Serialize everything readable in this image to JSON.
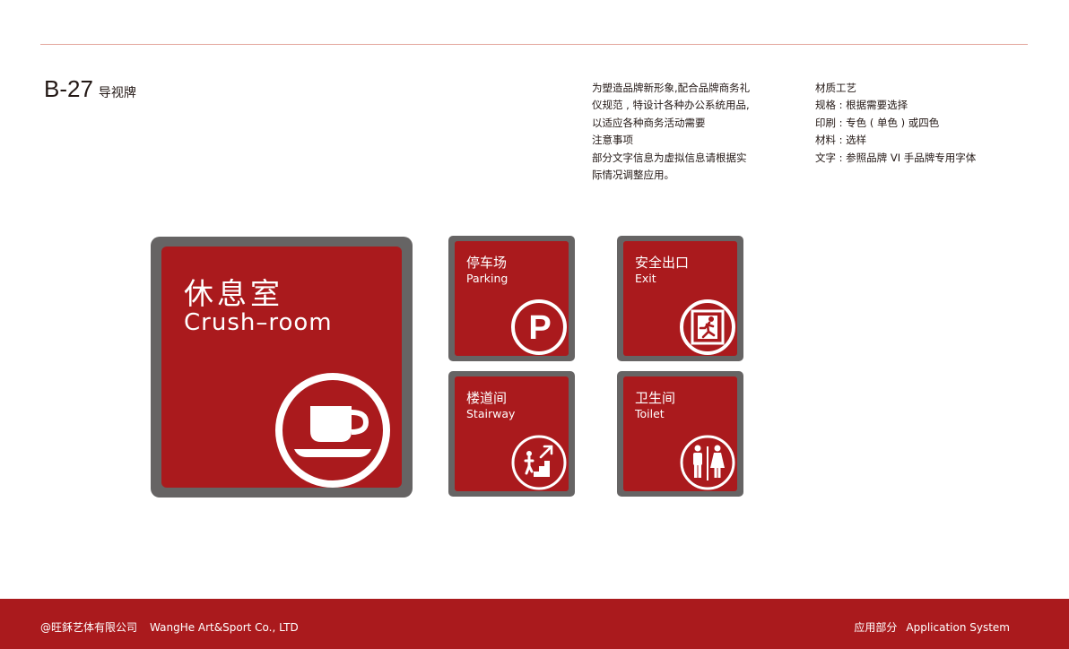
{
  "header": {
    "code": "B-27",
    "title": "导视牌"
  },
  "description": [
    "为塑造品牌新形象,配合品牌商务礼",
    "仪规范 , 特设计各种办公系统用品,",
    "以适应各种商务活动需要",
    "注意事项",
    "部分文字信息为虚拟信息请根据实",
    "际情况调整应用。"
  ],
  "specs": [
    "材质工艺",
    "规格 : 根据需要选择",
    "印刷 : 专色 ( 单色 ) 或四色",
    "材料 : 选样",
    "文字 : 参照品牌 VI 手品牌专用字体"
  ],
  "signs": {
    "main": {
      "zh": "休息室",
      "en": "Crush–room",
      "icon": "coffee-cup-icon"
    },
    "parking": {
      "zh": "停车场",
      "en": "Parking",
      "icon": "parking-icon",
      "glyph": "P"
    },
    "exit": {
      "zh": "安全出口",
      "en": "Exit",
      "icon": "emergency-exit-icon"
    },
    "stairway": {
      "zh": "楼道间",
      "en": "Stairway",
      "icon": "stairway-icon"
    },
    "toilet": {
      "zh": "卫生间",
      "en": "Toilet",
      "icon": "toilet-icon"
    }
  },
  "colors": {
    "brand_red": "#aa1a1d",
    "frame_gray": "#666464",
    "rule": "#e3a59c"
  },
  "footer": {
    "company_cn": "@旺鉌艺体有限公司",
    "company_en": "WangHe Art&Sport Co., LTD",
    "section_cn": "应用部分",
    "section_en": "Application System"
  }
}
